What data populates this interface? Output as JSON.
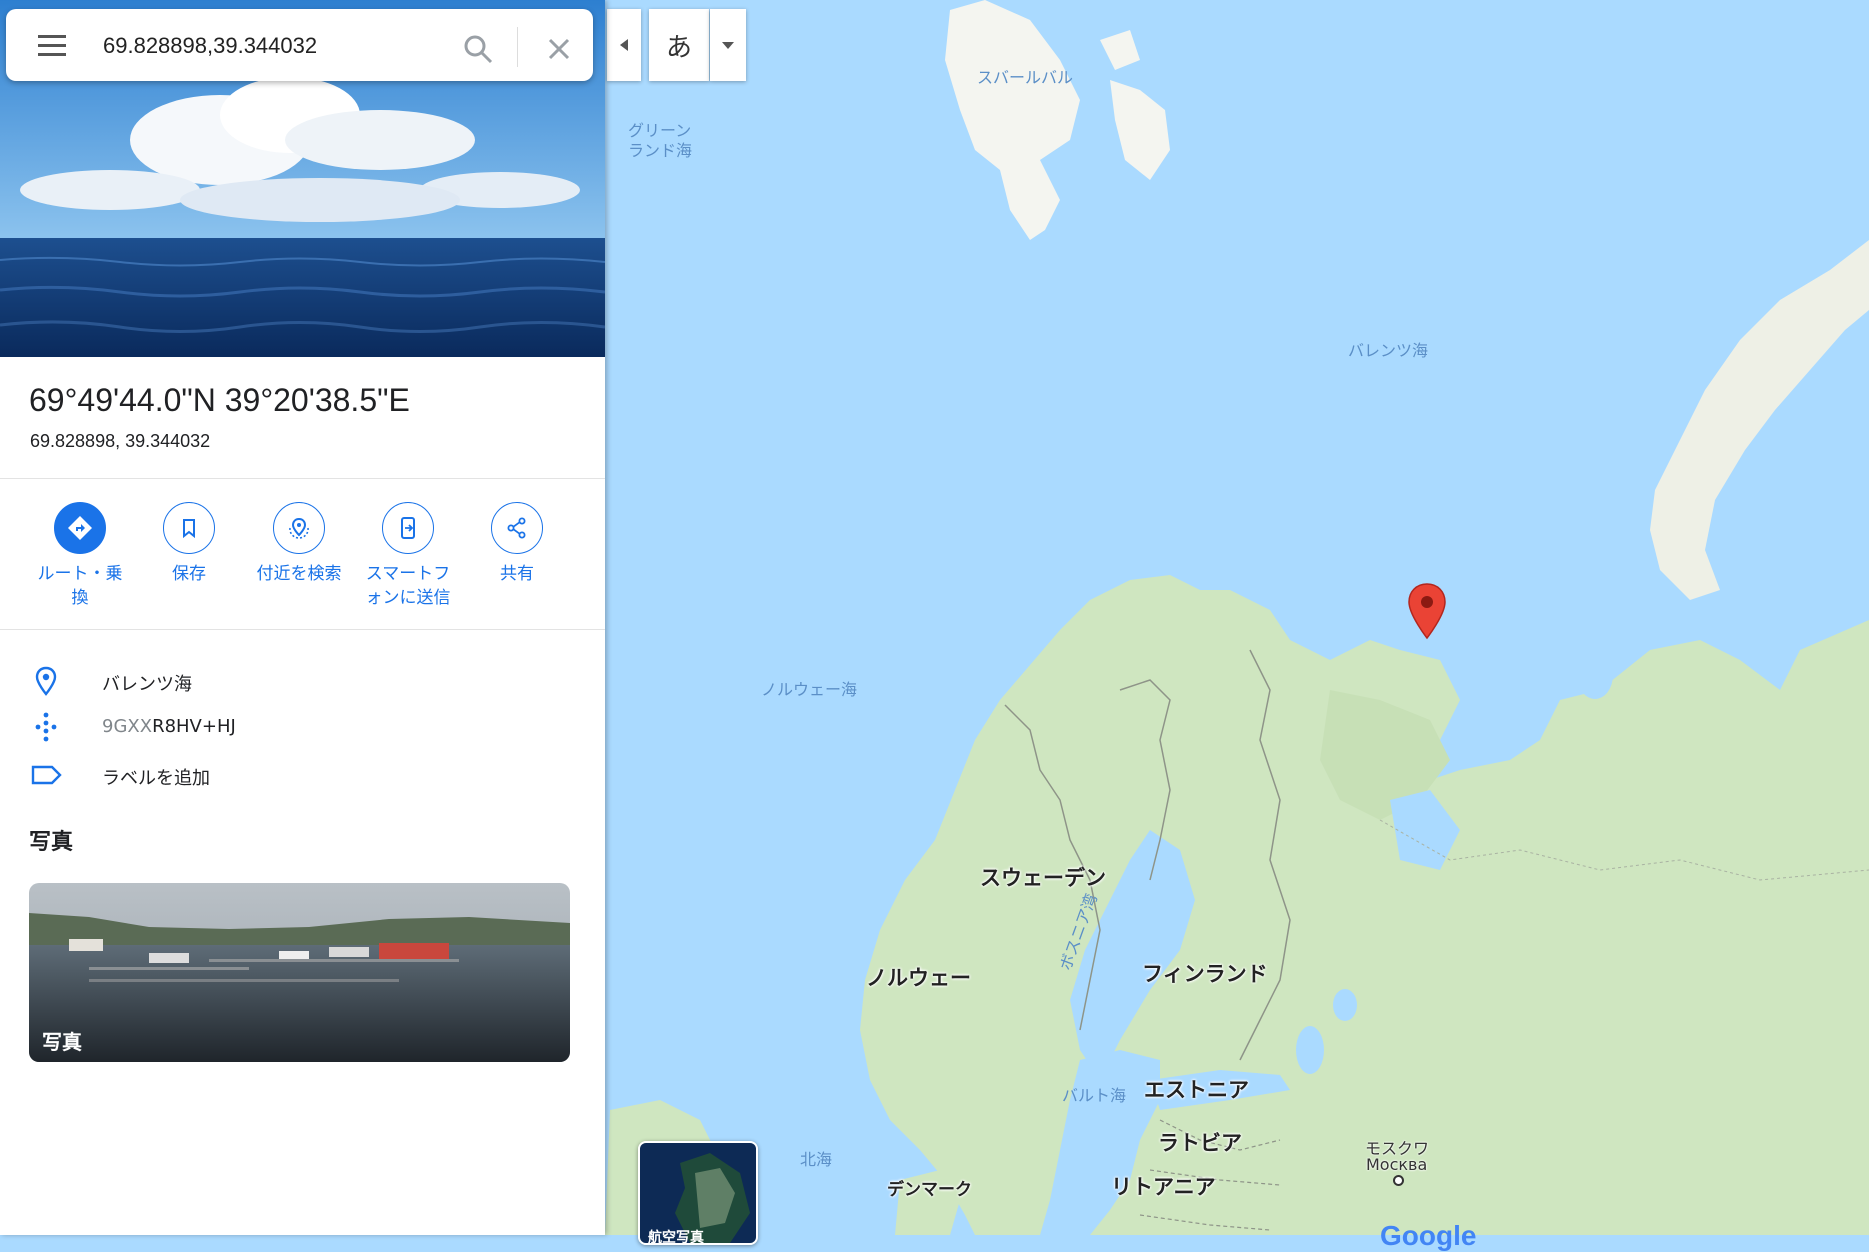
{
  "search": {
    "value": "69.828898,39.344032"
  },
  "place": {
    "title": "69°49'44.0\"N 39°20'38.5\"E",
    "subtitle": "69.828898, 39.344032"
  },
  "actions": [
    {
      "label": "ルート・乗\n換",
      "icon": "directions-icon"
    },
    {
      "label": "保存",
      "icon": "bookmark-icon"
    },
    {
      "label": "付近を検索",
      "icon": "nearby-icon"
    },
    {
      "label": "スマートフ\nォンに送信",
      "icon": "send-to-phone-icon"
    },
    {
      "label": "共有",
      "icon": "share-icon"
    }
  ],
  "info": {
    "location_name": "バレンツ海",
    "plus_code_prefix": "9GXX",
    "plus_code_main": "R8HV+HJ",
    "add_label": "ラベルを追加"
  },
  "photos": {
    "heading": "写真",
    "card_label": "写真"
  },
  "controls": {
    "ime_char": "あ",
    "layer_label": "航空写真"
  },
  "map_labels": {
    "svalbard": "スバールバル",
    "greenland_sea_1": "グリーン",
    "greenland_sea_2": "ランド海",
    "barents_sea": "バレンツ海",
    "norwegian_sea": "ノルウェー海",
    "sweden": "スウェーデン",
    "norway": "ノルウェー",
    "finland": "フィンランド",
    "bothnia": "ボスニア湾",
    "baltic_sea": "バルト海",
    "estonia": "エストニア",
    "latvia": "ラトビア",
    "lithuania": "リトアニア",
    "north_sea": "北海",
    "denmark": "デンマーク",
    "moscow_ja": "モスクワ",
    "moscow_ru": "Москва"
  },
  "logo": "Google",
  "colors": {
    "accent": "#1a73e8",
    "water": "#aadaff",
    "land": "#cfe6c0",
    "pin": "#ea4335"
  }
}
